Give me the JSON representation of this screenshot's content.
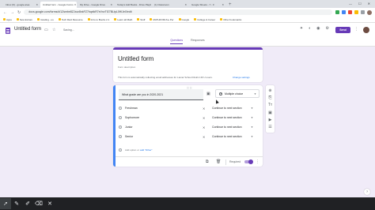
{
  "browser": {
    "tabs": [
      {
        "label": "Inbox (9) - google.area",
        "active": false
      },
      {
        "label": "Untitled form - Google Forms",
        "active": true
      },
      {
        "label": "My Drive - Google Drive",
        "active": false
      },
      {
        "label": "Today's Add Books - Drive Playlist",
        "active": false
      },
      {
        "label": "(1) Classroom",
        "active": false
      },
      {
        "label": "Google Sheets - Y - F",
        "active": false
      }
    ],
    "url": "docs.google.com/forms/d/1Zsmbe8ZJxzz8nkFZ7bqxtkR7eVnvTf27BLtpL0HIJe0/edit",
    "bookmarks": [
      "Apps",
      "New Extram",
      "Grading - us",
      "Tech Rwd Resource",
      "Intro to Boobs 2.1",
      "Learn all Math",
      "Stuff",
      "MATHFORLS ▸ Per",
      "Google",
      "College & Career",
      "Other bookmarks"
    ]
  },
  "forms_header": {
    "title": "Untitled form",
    "saving": "Saving...",
    "send_label": "Send",
    "tabs": [
      {
        "label": "Questions",
        "active": true
      },
      {
        "label": "Responses",
        "active": false
      }
    ]
  },
  "title_card": {
    "title": "Untitled form",
    "description": "Form description",
    "note": "This form is automatically collecting email addresses for Lamar School District 46 U users.",
    "link": "Change settings"
  },
  "question": {
    "title": "What grade are you in 2020-2021",
    "type_label": "Multiple choice",
    "options": [
      {
        "label": "Freshman",
        "section": "Continue to next section"
      },
      {
        "label": "Sophomore",
        "section": "Continue to next section"
      },
      {
        "label": "Junior",
        "section": "Continue to next section"
      },
      {
        "label": "Senior",
        "section": "Continue to next section"
      }
    ],
    "add_option": "Add option",
    "or": "or",
    "add_other": "add \"Other\"",
    "required_label": "Required",
    "required": true
  },
  "colors": {
    "accent": "#673ab7",
    "canvas": "#f0ebf8",
    "active_card": "#4285f4"
  },
  "icons": {
    "image": "image-icon",
    "copy": "copy-icon",
    "trash": "trash-icon"
  }
}
